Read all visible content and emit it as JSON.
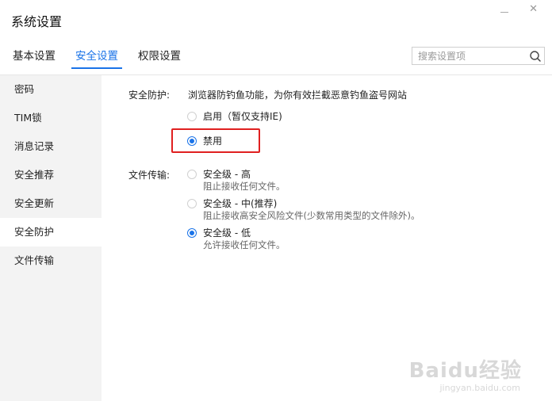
{
  "window": {
    "title": "系统设置",
    "minimize_icon": "minimize-icon",
    "close_icon": "close-icon"
  },
  "tabs": [
    {
      "label": "基本设置",
      "active": false
    },
    {
      "label": "安全设置",
      "active": true
    },
    {
      "label": "权限设置",
      "active": false
    }
  ],
  "search": {
    "placeholder": "搜索设置项",
    "icon": "search-icon"
  },
  "sidebar": {
    "items": [
      {
        "label": "密码",
        "active": false
      },
      {
        "label": "TIM锁",
        "active": false
      },
      {
        "label": "消息记录",
        "active": false
      },
      {
        "label": "安全推荐",
        "active": false
      },
      {
        "label": "安全更新",
        "active": false
      },
      {
        "label": "安全防护",
        "active": true
      },
      {
        "label": "文件传输",
        "active": false
      }
    ]
  },
  "security_protection": {
    "label": "安全防护:",
    "description": "浏览器防钓鱼功能，为你有效拦截恶意钓鱼盗号网站",
    "options": [
      {
        "label": "启用（暂仅支持IE)",
        "checked": false
      },
      {
        "label": "禁用",
        "checked": true
      }
    ]
  },
  "file_transfer": {
    "label": "文件传输:",
    "options": [
      {
        "label": "安全级 - 高",
        "sub": "阻止接收任何文件。",
        "checked": false
      },
      {
        "label": "安全级 - 中(推荐)",
        "sub": "阻止接收高安全风险文件(少数常用类型的文件除外)。",
        "checked": false
      },
      {
        "label": "安全级 - 低",
        "sub": "允许接收任何文件。",
        "checked": true
      }
    ]
  },
  "colors": {
    "accent": "#1a73e8",
    "highlight_border": "#e02020",
    "sidebar_bg": "#f3f3f3"
  },
  "watermark": {
    "brand": "Baidu经验",
    "url": "jingyan.baidu.com"
  }
}
